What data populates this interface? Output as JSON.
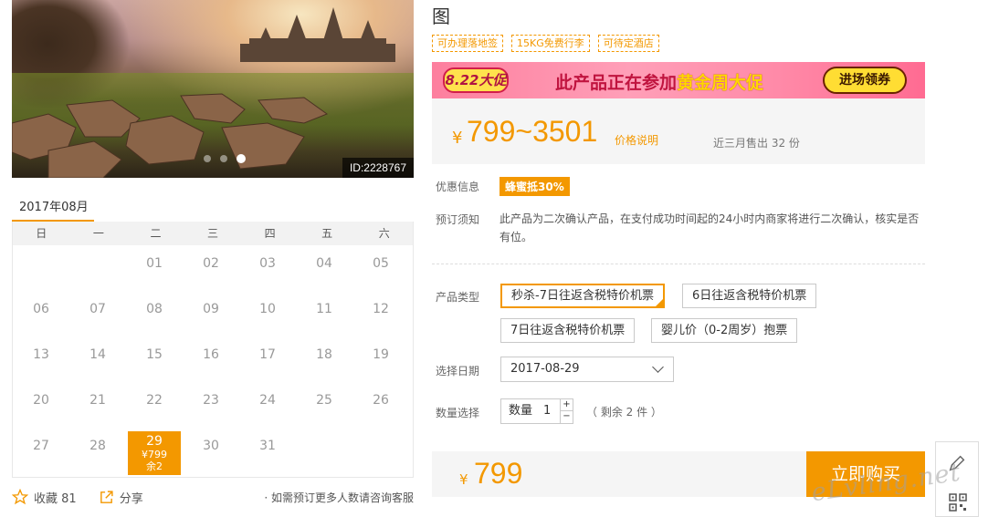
{
  "hero": {
    "id_tag": "ID:2228767",
    "slides": 3,
    "active_slide": 3
  },
  "calendar": {
    "month_title": "2017年08月",
    "weekdays": [
      "日",
      "一",
      "二",
      "三",
      "四",
      "五",
      "六"
    ],
    "days": [
      "",
      "",
      "01",
      "02",
      "03",
      "04",
      "05",
      "06",
      "07",
      "08",
      "09",
      "10",
      "11",
      "12",
      "13",
      "14",
      "15",
      "16",
      "17",
      "18",
      "19",
      "20",
      "21",
      "22",
      "23",
      "24",
      "25",
      "26",
      "27",
      "28",
      "29",
      "30",
      "31",
      "",
      ""
    ],
    "selected_day": "29",
    "selected_price": "¥799",
    "selected_left": "余2"
  },
  "footer_left": {
    "favorite_label": "收藏 81",
    "share_label": "分享",
    "consult_text": "· 如需预订更多人数请咨询客服"
  },
  "product": {
    "title_fragment": "图",
    "tags": [
      "可办理落地签",
      "15KG免费行李",
      "可待定酒店"
    ]
  },
  "promo": {
    "badge": "8.22大促",
    "message_prefix": "此产品正在参加",
    "message_highlight": "黄金周大促",
    "cta_label": "进场领券"
  },
  "price": {
    "currency": "¥",
    "range": "799~3501",
    "explain_link": "价格说明",
    "sold_text": "近三月售出 32 份"
  },
  "info": {
    "discount_label": "优惠信息",
    "discount_badge": "蜂蜜抵30%",
    "notice_label": "预订须知",
    "notice_text": "此产品为二次确认产品，在支付成功时间起的24小时内商家将进行二次确认，核实是否有位。"
  },
  "options": {
    "type_label": "产品类型",
    "types": [
      "秒杀-7日往返含税特价机票",
      "6日往返含税特价机票",
      "7日往返含税特价机票",
      "婴儿价（0-2周岁）抱票"
    ],
    "date_label": "选择日期",
    "date_value": "2017-08-29",
    "qty_label": "数量选择",
    "qty_prefix": "数量",
    "qty_value": "1",
    "qty_plus": "+",
    "qty_minus": "−",
    "remain_text": "（ 剩余 2 件 ）"
  },
  "buy": {
    "currency": "¥",
    "amount": "799",
    "button_label": "立即购买"
  },
  "watermark": "eLvling.net",
  "colors": {
    "accent": "#f39800",
    "promo_pink": "#ff8aa8"
  }
}
